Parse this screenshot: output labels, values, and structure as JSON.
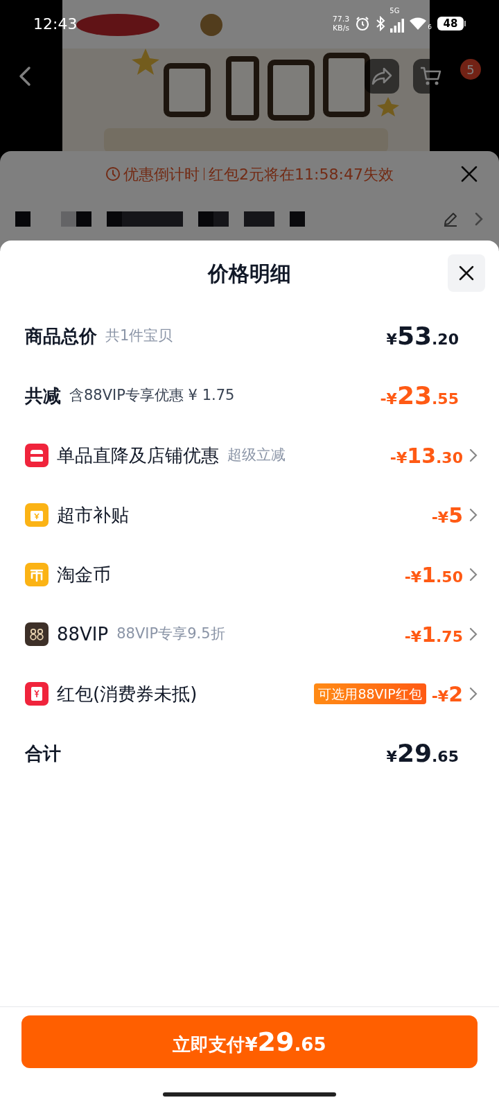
{
  "status_bar": {
    "time": "12:43",
    "net_speed": "77.3",
    "net_unit": "KB/s",
    "network": "5G",
    "wifi_level": "6",
    "battery": "48"
  },
  "nav": {
    "cart_badge": "5"
  },
  "countdown": {
    "label": "优惠倒计时",
    "message": "红包2元将在11:58:47失效"
  },
  "sheet": {
    "title": "价格明细",
    "rows": [
      {
        "kind": "summary",
        "label": "商品总价",
        "note": "共1件宝贝",
        "amount": {
          "prefix": "¥",
          "integer": "53",
          "decimal": ".20"
        }
      },
      {
        "kind": "summary_discount",
        "label": "共减",
        "note": "含88VIP专享优惠 ¥ 1.75",
        "amount": {
          "prefix": "-¥",
          "integer": "23",
          "decimal": ".55"
        }
      },
      {
        "kind": "discount",
        "label": "单品直降及店铺优惠",
        "note": "超级立减",
        "amount": {
          "prefix": "-¥",
          "integer": "13",
          "decimal": ".30"
        }
      },
      {
        "kind": "discount",
        "label": "超市补贴",
        "amount": {
          "prefix": "-¥",
          "integer": "5"
        }
      },
      {
        "kind": "discount",
        "label": "淘金币",
        "amount": {
          "prefix": "-¥",
          "integer": "1",
          "decimal": ".50"
        }
      },
      {
        "kind": "discount",
        "label": "88VIP",
        "note": "88VIP专享9.5折",
        "amount": {
          "prefix": "-¥",
          "integer": "1",
          "decimal": ".75"
        }
      },
      {
        "kind": "discount",
        "label": "红包(消费券未抵)",
        "tag": "可选用88VIP红包",
        "amount": {
          "prefix": "-¥",
          "integer": "2"
        }
      },
      {
        "kind": "summary",
        "label": "合计",
        "amount": {
          "prefix": "¥",
          "integer": "29",
          "decimal": ".65"
        }
      }
    ]
  },
  "pay_button": {
    "label": "立即支付",
    "amount": {
      "prefix": "¥",
      "integer": "29",
      "decimal": ".65"
    }
  }
}
